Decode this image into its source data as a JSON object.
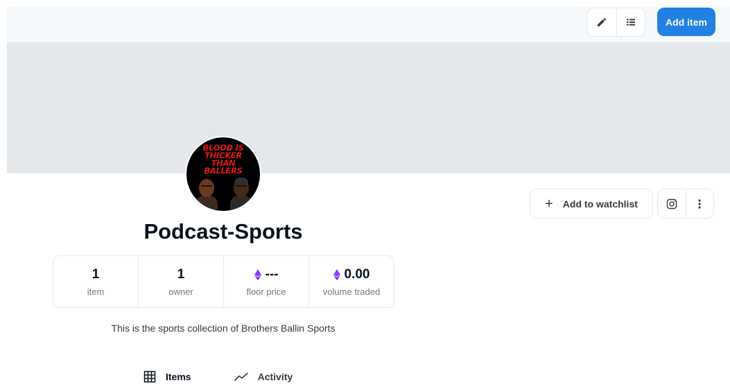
{
  "header": {
    "add_item_label": "Add item",
    "icons": [
      "edit-pencil-icon",
      "list-view-icon"
    ],
    "accent_color": "#2081e2"
  },
  "collection": {
    "avatar_text_lines": [
      "BLOOD IS",
      "THICKER",
      "THAN",
      "BALLERS"
    ],
    "name": "Podcast-Sports",
    "description": "This is the sports collection of Brothers Ballin Sports"
  },
  "stats": [
    {
      "value": "1",
      "label": "item",
      "currency": false
    },
    {
      "value": "1",
      "label": "owner",
      "currency": false
    },
    {
      "value": "---",
      "label": "floor price",
      "currency": true
    },
    {
      "value": "0.00",
      "label": "volume traded",
      "currency": true
    }
  ],
  "actions": {
    "watchlist_label": "Add to watchlist",
    "icons": [
      "instagram-icon",
      "more-vertical-icon"
    ]
  },
  "tabs": [
    {
      "label": "Items",
      "icon": "grid-icon",
      "active": true
    },
    {
      "label": "Activity",
      "icon": "activity-chart-icon",
      "active": false
    }
  ]
}
